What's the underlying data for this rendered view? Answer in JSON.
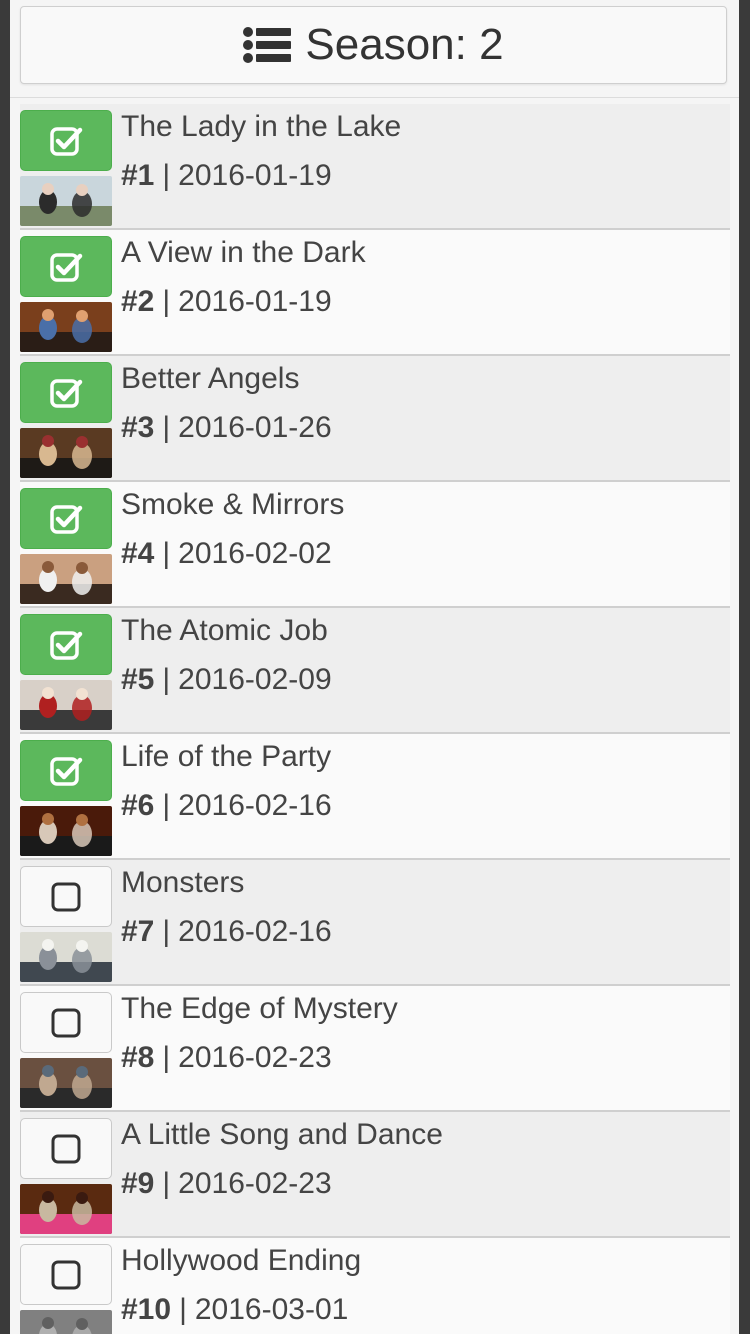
{
  "header": {
    "title": "Season: 2",
    "icon": "list-icon"
  },
  "colors": {
    "checked_bg": "#5cb85c",
    "unchecked_bg": "#f9f9f9",
    "row_odd": "#eeeeee",
    "row_even": "#fafafa"
  },
  "episodes": [
    {
      "title": "The Lady in the Lake",
      "number": "#1",
      "separator": "|",
      "date": "2016-01-19",
      "watched": true
    },
    {
      "title": "A View in the Dark",
      "number": "#2",
      "separator": "|",
      "date": "2016-01-19",
      "watched": true
    },
    {
      "title": "Better Angels",
      "number": "#3",
      "separator": "|",
      "date": "2016-01-26",
      "watched": true
    },
    {
      "title": "Smoke & Mirrors",
      "number": "#4",
      "separator": "|",
      "date": "2016-02-02",
      "watched": true
    },
    {
      "title": "The Atomic Job",
      "number": "#5",
      "separator": "|",
      "date": "2016-02-09",
      "watched": true
    },
    {
      "title": "Life of the Party",
      "number": "#6",
      "separator": "|",
      "date": "2016-02-16",
      "watched": true
    },
    {
      "title": "Monsters",
      "number": "#7",
      "separator": "|",
      "date": "2016-02-16",
      "watched": false
    },
    {
      "title": "The Edge of Mystery",
      "number": "#8",
      "separator": "|",
      "date": "2016-02-23",
      "watched": false
    },
    {
      "title": "A Little Song and Dance",
      "number": "#9",
      "separator": "|",
      "date": "2016-02-23",
      "watched": false
    },
    {
      "title": "Hollywood Ending",
      "number": "#10",
      "separator": "|",
      "date": "2016-03-01",
      "watched": false
    }
  ]
}
